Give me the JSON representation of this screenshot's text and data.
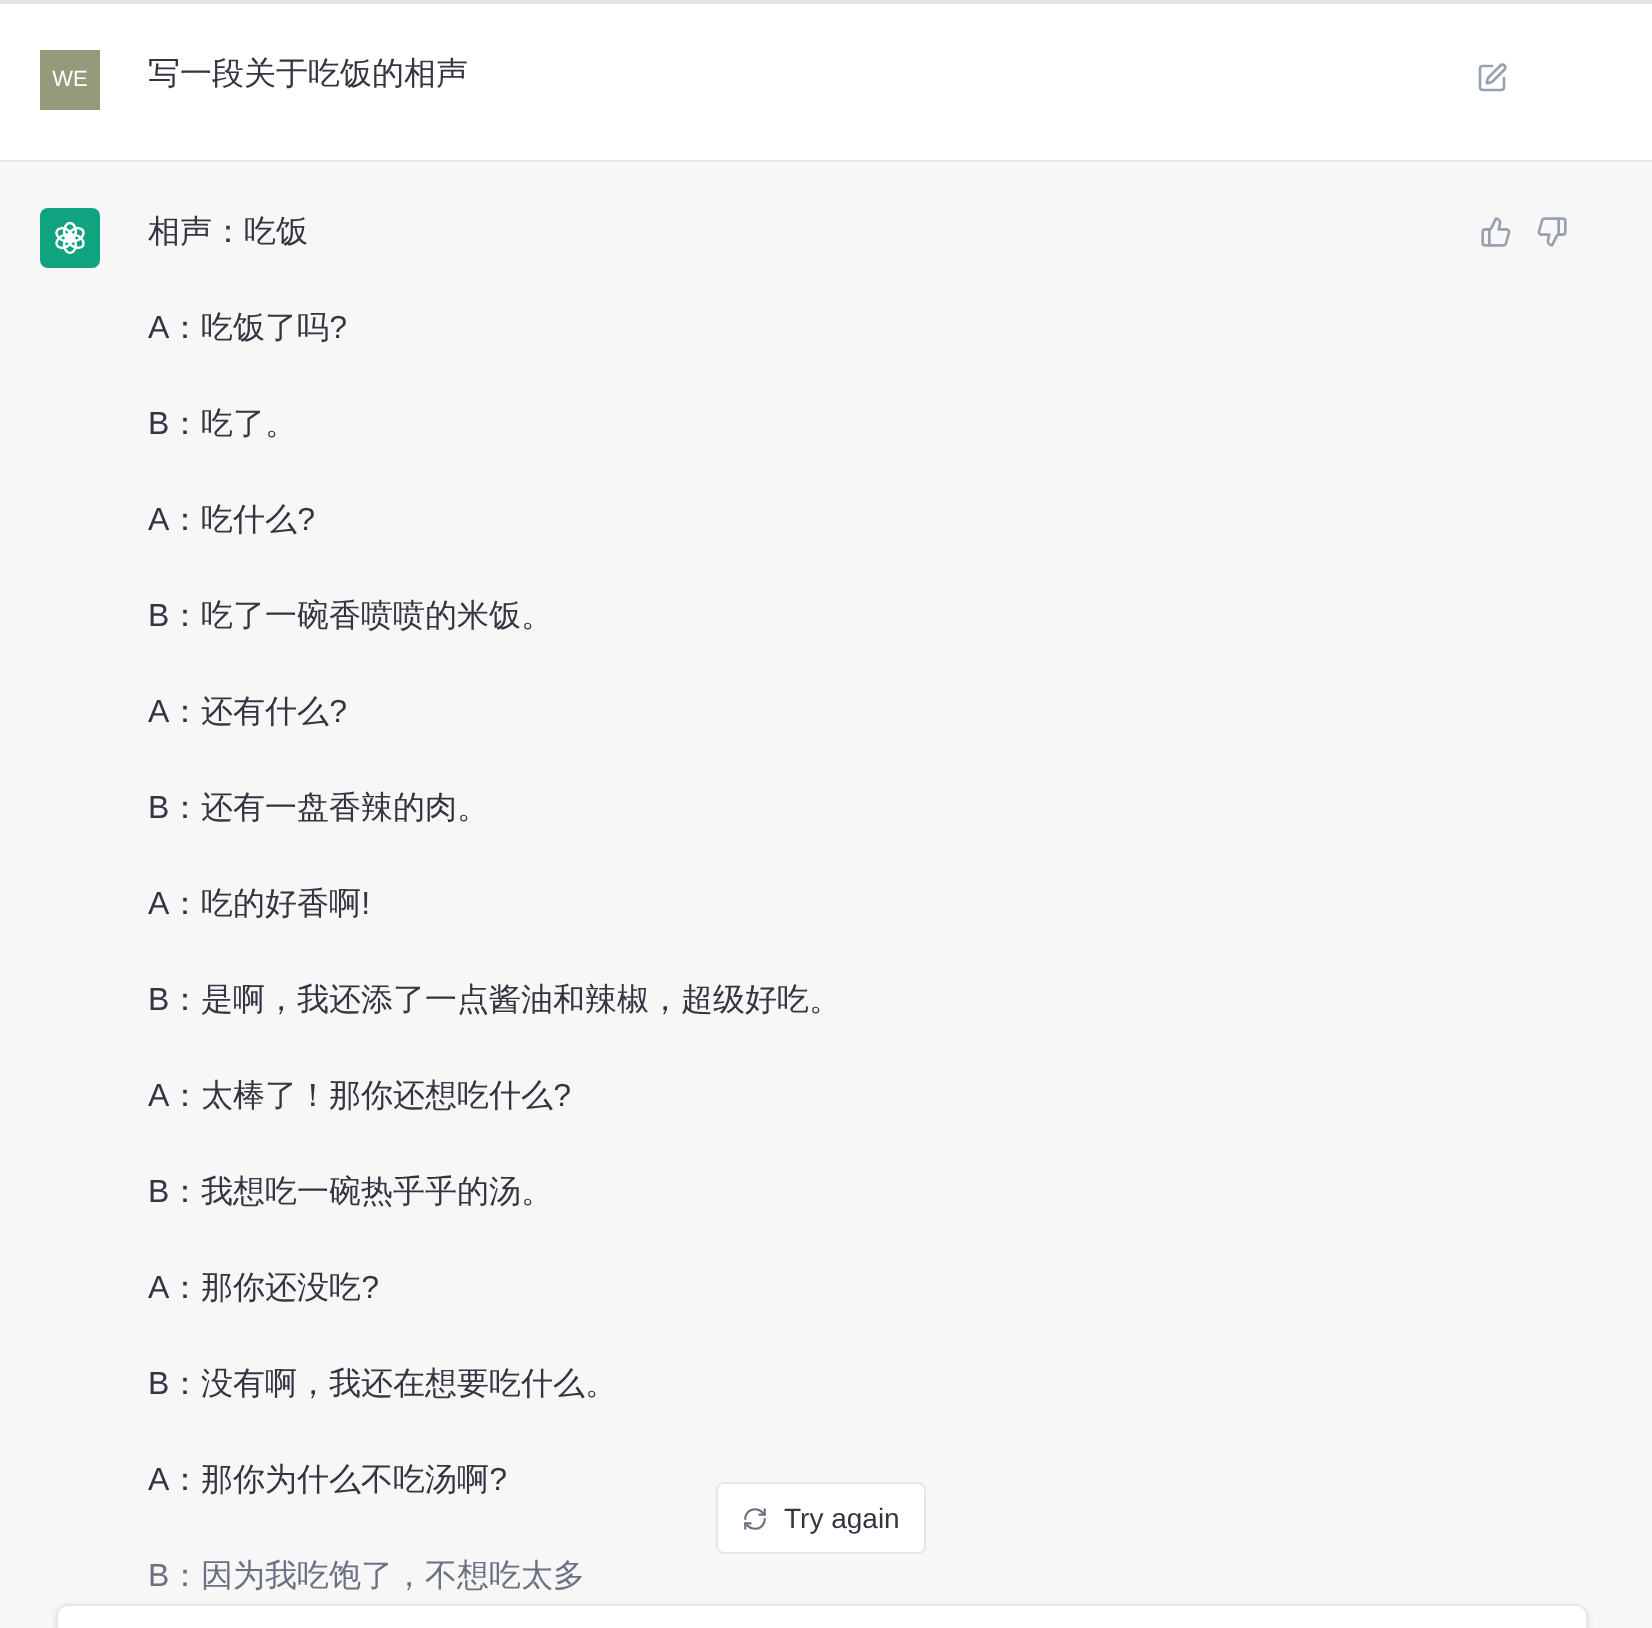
{
  "user_message": {
    "avatar": "WE",
    "text": "写一段关于吃饭的相声"
  },
  "assistant_message": {
    "lines": [
      "相声：吃饭",
      "A：吃饭了吗?",
      "B：吃了。",
      "A：吃什么?",
      "B：吃了一碗香喷喷的米饭。",
      "A：还有什么?",
      "B：还有一盘香辣的肉。",
      "A：吃的好香啊!",
      "B：是啊，我还添了一点酱油和辣椒，超级好吃。",
      "A：太棒了！那你还想吃什么?",
      "B：我想吃一碗热乎乎的汤。",
      "A：那你还没吃?",
      "B：没有啊，我还在想要吃什么。",
      "A：那你为什么不吃汤啊?",
      "B：因为我吃饱了，不想吃太多"
    ]
  },
  "try_again_button": {
    "label": "Try again"
  }
}
